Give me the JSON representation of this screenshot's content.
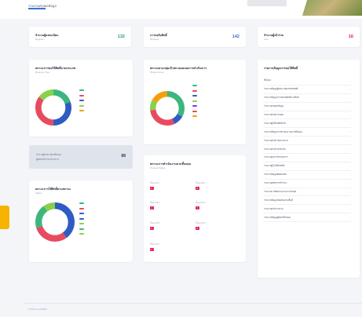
{
  "header": {
    "breadcrumb": "รายงานสรุปผลข้อมูล"
  },
  "colors": {
    "red": "#e84a5f",
    "blue": "#2f5cc4",
    "green": "#3bb77e",
    "light_green": "#8ad04a",
    "orange": "#f59e0b",
    "purple": "#7c3aed",
    "stat_green": "#22a06b",
    "stat_blue": "#3b6fd4",
    "stat_red": "#e11d48"
  },
  "stats": [
    {
      "title": "จำนวนผู้ลงทะเบียน",
      "sub": "Register",
      "value": "132",
      "color": "#22a06b"
    },
    {
      "title": "การขอรับสิทธิ์",
      "sub": "Request",
      "value": "142",
      "color": "#3b6fd4"
    },
    {
      "title": "จำนวนผู้เข้าร่วม",
      "sub": "Join",
      "value": "16",
      "color": "#e11d48"
    }
  ],
  "chart1": {
    "title": "สถานะการขอใช้สิทธิ์ตามประเภท",
    "sub": "Request Type"
  },
  "chart2": {
    "title": "สถานะการใช้สิทธิ์ตามสถานะ",
    "sub": "Status"
  },
  "chart3": {
    "title": "สถานะตามกลุ่มเป้าหมายและผลการดำเนินการ",
    "sub": "Target Group"
  },
  "summary": {
    "line1": "จำนวนผู้ลงทะเบียนทั้งหมด",
    "line2": "ผู้สมัครเข้าร่วมโครงการ",
    "value": "88"
  },
  "status_block": {
    "title": "สถานะการดำเนินงานตามขั้นตอน",
    "sub": "Process Stage",
    "items": [
      {
        "label": "ขั้นตอนที่ 1",
        "badge": "0"
      },
      {
        "label": "ขั้นตอนที่ 2",
        "badge": "0"
      },
      {
        "label": "ขั้นตอนที่ 3",
        "badge": "0"
      },
      {
        "label": "ขั้นตอนที่ 4",
        "badge": "0"
      },
      {
        "label": "ขั้นตอนที่ 5",
        "badge": "0"
      },
      {
        "label": "ขั้นตอนที่ 6",
        "badge": "0"
      },
      {
        "label": "ขั้นตอนที่ 7",
        "badge": "0"
      }
    ]
  },
  "report_list": {
    "title": "รายงานข้อมูลการขอใช้สิทธิ์",
    "items": [
      "ทั้งหมด",
      "รายงานข้อมูลผู้ลงทะเบียนขอรับสิทธิ์",
      "รายงานข้อมูลการขอรับสิทธิ์ตามพื้นที่",
      "รายงานสรุปผลข้อมูล",
      "รายงานสรุปตามกลุ่ม",
      "รายงานผู้ได้รับสิทธิ์แล้ว",
      "รายงานข้อมูลการดำเนินงานตามขั้นตอน",
      "รายงานสรุปรายหน่วยงาน",
      "รายงานสรุปรายจังหวัด",
      "รายงานผลการดำเนินการ",
      "รายงานผู้ไม่ได้รับสิทธิ์",
      "รายงานข้อมูลติดต่อกลับ",
      "รายงานสถิติการเข้าร่วม",
      "รายงานการติดตามและประเมินผล",
      "รายงานข้อมูลเพิ่มเติมตามพื้นที่",
      "รายงานสรุปภาพรวม",
      "รายงานข้อมูลผู้สมัครทั้งหมด"
    ]
  },
  "footer": {
    "text": "© 2023 สงวนลิขสิทธิ์"
  },
  "chart_data": [
    {
      "type": "pie",
      "series": [
        {
          "value": 20,
          "color": "#3bb77e"
        },
        {
          "value": 30,
          "color": "#2f5cc4"
        },
        {
          "value": 35,
          "color": "#e84a5f"
        },
        {
          "value": 15,
          "color": "#8ad04a"
        }
      ]
    },
    {
      "type": "pie",
      "series": [
        {
          "value": 40,
          "color": "#2f5cc4"
        },
        {
          "value": 30,
          "color": "#e84a5f"
        },
        {
          "value": 20,
          "color": "#3bb77e"
        },
        {
          "value": 10,
          "color": "#8ad04a"
        }
      ]
    },
    {
      "type": "pie",
      "series": [
        {
          "value": 33,
          "color": "#3bb77e"
        },
        {
          "value": 10,
          "color": "#2f5cc4"
        },
        {
          "value": 30,
          "color": "#e84a5f"
        },
        {
          "value": 10,
          "color": "#8ad04a"
        },
        {
          "value": 17,
          "color": "#f59e0b"
        }
      ]
    }
  ]
}
